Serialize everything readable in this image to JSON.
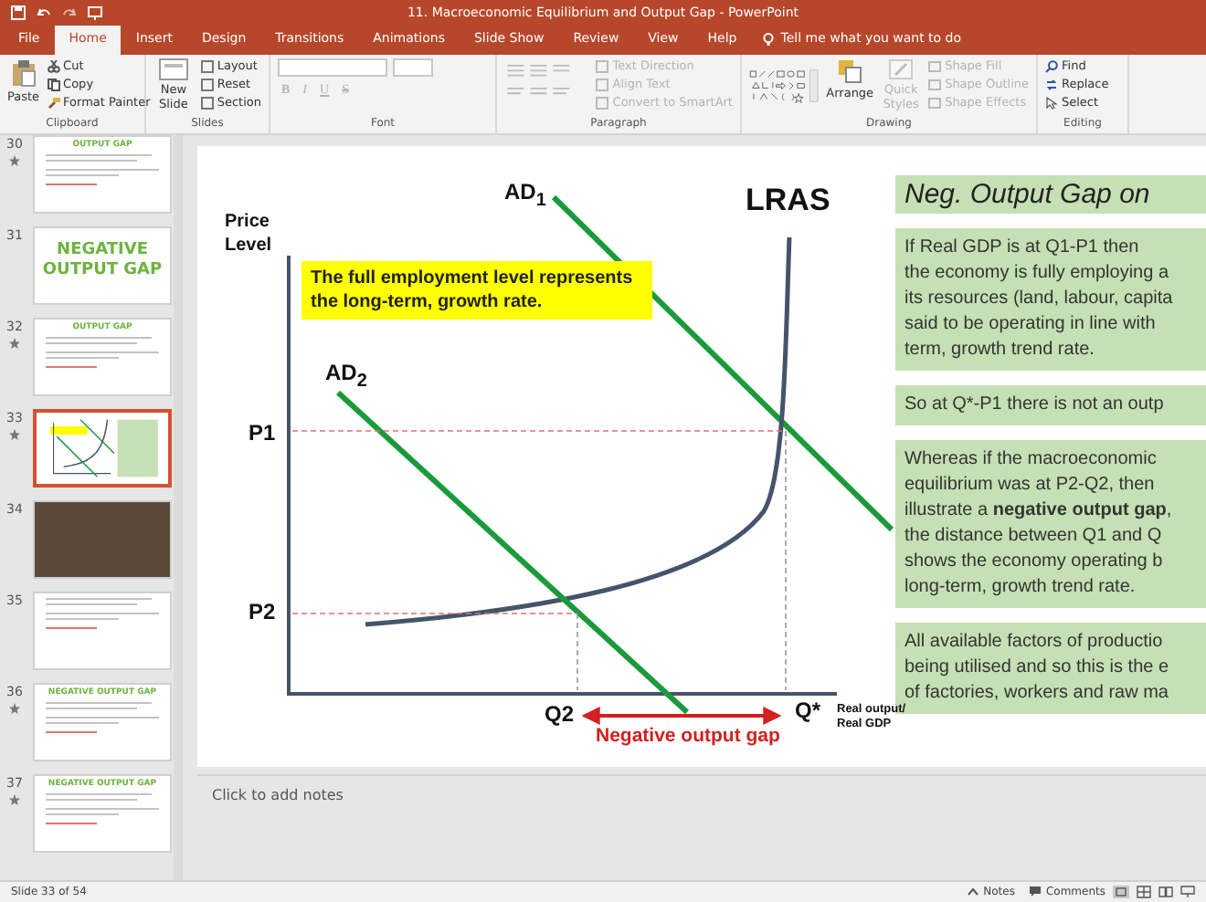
{
  "window": {
    "title": "11. Macroeconomic Equilibrium and Output Gap  -  PowerPoint"
  },
  "tabs": [
    {
      "label": "File",
      "selected": false
    },
    {
      "label": "Home",
      "selected": true
    },
    {
      "label": "Insert",
      "selected": false
    },
    {
      "label": "Design",
      "selected": false
    },
    {
      "label": "Transitions",
      "selected": false
    },
    {
      "label": "Animations",
      "selected": false
    },
    {
      "label": "Slide Show",
      "selected": false
    },
    {
      "label": "Review",
      "selected": false
    },
    {
      "label": "View",
      "selected": false
    },
    {
      "label": "Help",
      "selected": false
    }
  ],
  "tell_me": {
    "placeholder": "Tell me what you want to do"
  },
  "ribbon": {
    "clipboard": {
      "paste": "Paste",
      "items": [
        "Cut",
        "Copy",
        "Format Painter"
      ],
      "label": "Clipboard"
    },
    "slides": {
      "new_slide": "New Slide",
      "items": [
        "Layout",
        "Reset",
        "Section"
      ],
      "label": "Slides"
    },
    "font": {
      "buttons": [
        {
          "label": "B",
          "disabled": true
        },
        {
          "label": "I",
          "disabled": true
        },
        {
          "label": "U",
          "disabled": true
        },
        {
          "label": "S",
          "disabled": true
        }
      ],
      "label": "Font"
    },
    "paragraph": {
      "items": [
        {
          "label": "Text Direction",
          "disabled": true
        },
        {
          "label": "Align Text",
          "disabled": true
        },
        {
          "label": "Convert to SmartArt",
          "disabled": true
        }
      ],
      "label": "Paragraph"
    },
    "drawing": {
      "arrange": {
        "label": "Arrange",
        "disabled": false
      },
      "quick_styles": {
        "label": "Quick Styles",
        "disabled": true
      },
      "items": [
        {
          "label": "Shape Fill",
          "disabled": true
        },
        {
          "label": "Shape Outline",
          "disabled": true
        },
        {
          "label": "Shape Effects",
          "disabled": true
        }
      ],
      "label": "Drawing"
    },
    "editing": {
      "items": [
        "Find",
        "Replace",
        "Select"
      ],
      "label": "Editing"
    }
  },
  "slides_panel": [
    {
      "number": "30",
      "kind": "text",
      "title": "OUTPUT GAP",
      "animated": true,
      "selected": false
    },
    {
      "number": "31",
      "kind": "title",
      "title": "NEGATIVE OUTPUT GAP",
      "animated": false,
      "selected": false
    },
    {
      "number": "32",
      "kind": "text",
      "title": "OUTPUT GAP",
      "animated": true,
      "selected": false
    },
    {
      "number": "33",
      "kind": "diagram",
      "animated": true,
      "selected": true
    },
    {
      "number": "34",
      "kind": "photo",
      "animated": false,
      "selected": false
    },
    {
      "number": "35",
      "kind": "text",
      "animated": false,
      "selected": false
    },
    {
      "number": "36",
      "kind": "text",
      "title": "NEGATIVE OUTPUT GAP",
      "animated": true,
      "selected": false
    },
    {
      "number": "37",
      "kind": "text",
      "title": "NEGATIVE OUTPUT GAP",
      "animated": true,
      "selected": false
    }
  ],
  "slide": {
    "diagram": {
      "y_axis_label": "Price Level",
      "x_axis_label": "Real output/ Real GDP",
      "note": "The full employment level represents the long-term, growth rate.",
      "gap_label": "Negative output gap",
      "labels": [
        {
          "kind": "ad1",
          "text": "AD$_{1}$"
        },
        {
          "kind": "lras",
          "text": "LRAS"
        },
        {
          "kind": "ad2",
          "text": "AD$_{2}$"
        },
        {
          "kind": "p1",
          "text": "P1"
        },
        {
          "kind": "p2",
          "text": "P2"
        },
        {
          "kind": "q2",
          "text": "Q2"
        },
        {
          "kind": "qstar",
          "text": "Q*"
        }
      ]
    },
    "heading": "Neg. Output Gap on",
    "boxes": [
      {
        "lines": [
          "If Real GDP is at Q1-P1 then",
          "the economy is fully employing a",
          "its resources (land, labour, capita",
          "said to be operating in line with",
          "term, growth trend rate."
        ]
      },
      {
        "lines": [
          "So at Q*-P1 there is not an outp"
        ]
      },
      {
        "lines": [
          "Whereas if the macroeconomic",
          "equilibrium was at P2-Q2, then",
          "illustrate a **negative output gap**,",
          "the distance between Q1 and Q",
          "shows the economy operating b",
          "long-term, growth trend rate."
        ]
      },
      {
        "lines": [
          "All available factors of productio",
          "being utilised and so this is the e",
          "of factories, workers and raw ma"
        ]
      }
    ]
  },
  "notes": {
    "placeholder": "Click to add notes"
  },
  "status_bar": {
    "slide_info": "Slide 33 of 54",
    "buttons": [
      "Notes",
      "Comments"
    ]
  }
}
